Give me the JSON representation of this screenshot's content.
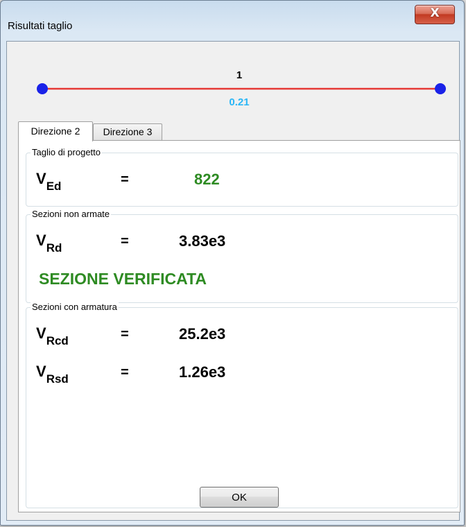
{
  "window": {
    "title": "Risultati taglio",
    "close_label": "X"
  },
  "beam": {
    "segment_number": "1",
    "segment_value": "0.21",
    "line_color": "#e53935",
    "node_color": "#1a22e8",
    "value_color": "#29b6f6"
  },
  "tabs": [
    {
      "label": "Direzione 2",
      "active": true
    },
    {
      "label": "Direzione 3",
      "active": false
    }
  ],
  "groups": {
    "design_shear": {
      "label": "Taglio di progetto",
      "symbol": "V",
      "subscript": "Ed",
      "equals": "=",
      "value": "822"
    },
    "unreinforced": {
      "label": "Sezioni non armate",
      "symbol": "V",
      "subscript": "Rd",
      "equals": "=",
      "value": "3.83e3",
      "status": "SEZIONE VERIFICATA"
    },
    "reinforced": {
      "label": "Sezioni con armatura",
      "rows": [
        {
          "symbol": "V",
          "subscript": "Rcd",
          "equals": "=",
          "value": "25.2e3"
        },
        {
          "symbol": "V",
          "subscript": "Rsd",
          "equals": "=",
          "value": "1.26e3"
        }
      ]
    }
  },
  "footer": {
    "ok_label": "OK"
  },
  "colors": {
    "verified": "#2e8b23"
  }
}
